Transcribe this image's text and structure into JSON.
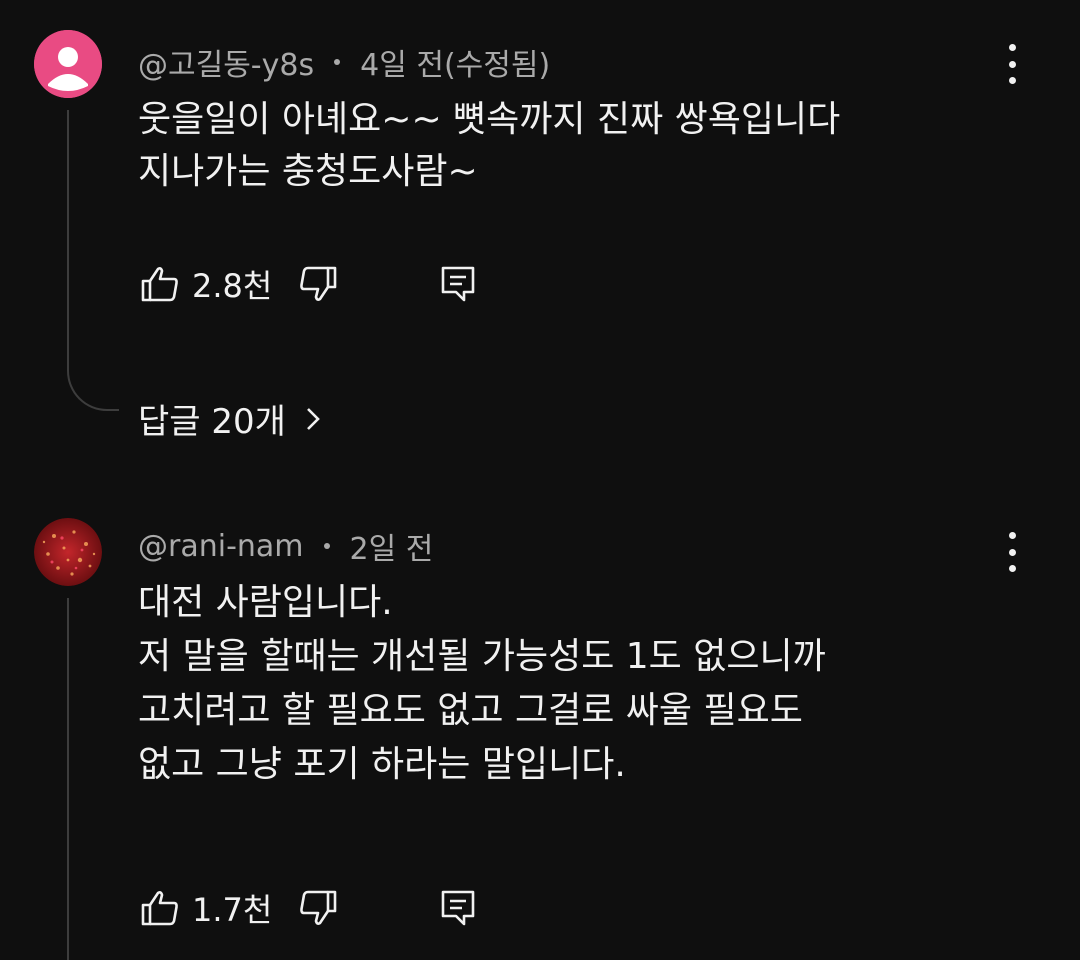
{
  "comments": [
    {
      "author": "@고길동-y8s",
      "time": "4일 전",
      "edited": "(수정됨)",
      "lines": [
        "웃을일이 아녜요~~ 뼛속까지 진짜 쌍욕입니다",
        "지나가는 충청도사람~"
      ],
      "likes": "2.8천",
      "replies_label": "답글 20개",
      "avatar_color": "#e94b83"
    },
    {
      "author": "@rani-nam",
      "time": "2일 전",
      "lines": [
        "대전 사람입니다.",
        "저 말을 할때는 개선될 가능성도 1도 없으니까",
        "고치려고 할 필요도 없고 그걸로 싸울 필요도",
        "없고 그냥 포기 하라는 말입니다."
      ],
      "likes": "1.7천",
      "avatar_color": "#8b0f14"
    }
  ],
  "icons": {
    "like": "thumbs-up-icon",
    "dislike": "thumbs-down-icon",
    "reply": "reply-icon",
    "more": "more-vert-icon",
    "chevron": "chevron-right-icon"
  },
  "colors": {
    "background": "#0f0f0f",
    "text": "#f1f1f1",
    "meta": "#aaaaaa"
  }
}
